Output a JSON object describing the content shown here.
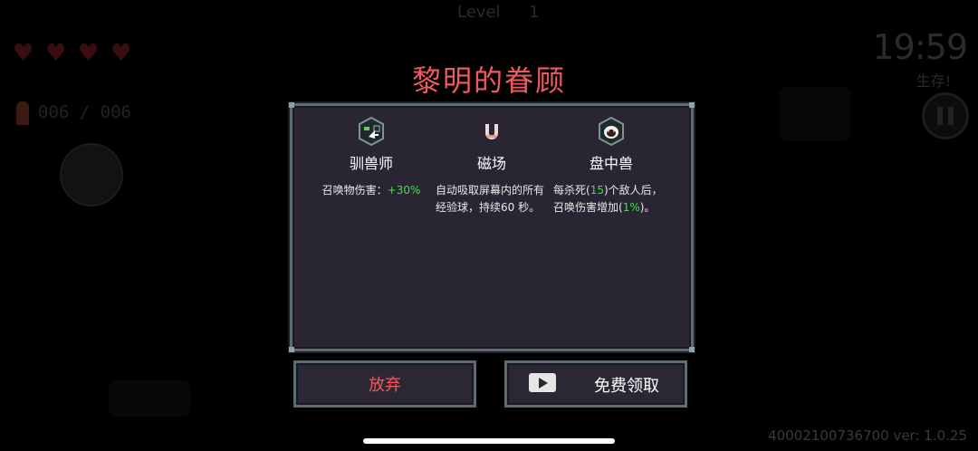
{
  "hud": {
    "level_label": "Level",
    "level_value": "1",
    "hearts": 4,
    "ammo": "006 / 006",
    "timer": "19:59",
    "survive": "生存!"
  },
  "dialog": {
    "title": "黎明的眷顾",
    "options": [
      {
        "name": "驯兽师",
        "icon": "beast-tamer-icon",
        "desc_prefix": "召唤物伤害：",
        "desc_highlight": "+30%",
        "desc_suffix": ""
      },
      {
        "name": "磁场",
        "icon": "magnet-icon",
        "desc_prefix": "自动吸取屏幕内的所有经验球，持续60 秒。",
        "desc_highlight": "",
        "desc_suffix": ""
      },
      {
        "name": "盘中兽",
        "icon": "fanged-beast-icon",
        "desc_prefix": "每杀死(",
        "desc_highlight": "15",
        "desc_mid": ")个敌人后，召唤伤害增加(",
        "desc_highlight2": "1%",
        "desc_suffix": ")。"
      }
    ],
    "giveup_label": "放弃",
    "free_claim_label": "免费领取"
  },
  "footer": {
    "version": "40002100736700 ver: 1.0.25"
  },
  "colors": {
    "title_red": "#f05a5e",
    "highlight_green": "#3ee04a",
    "panel_bg": "#2a2532",
    "panel_border": "#5d6b72"
  }
}
